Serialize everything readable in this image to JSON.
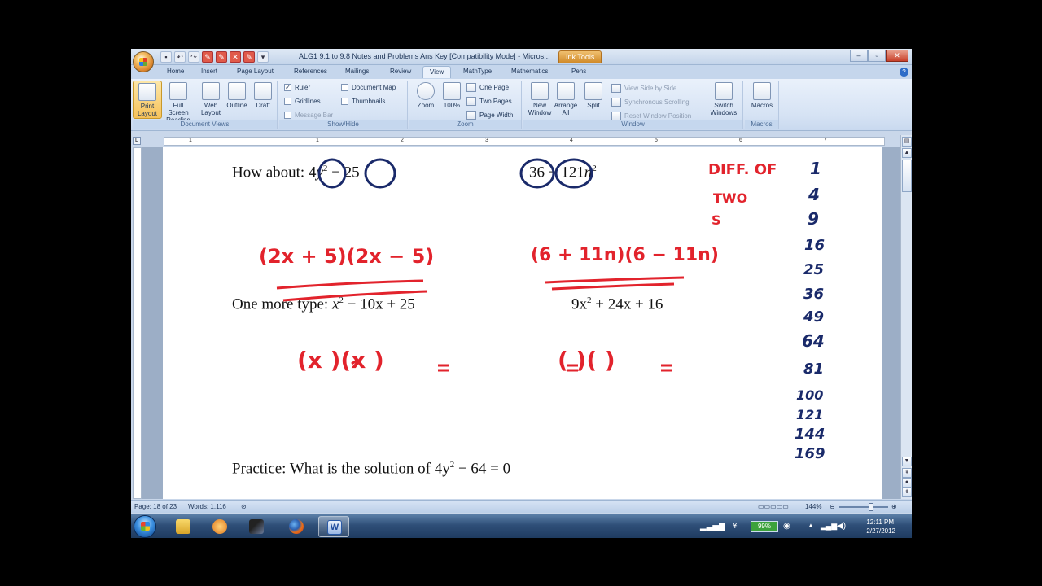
{
  "window": {
    "title": "ALG1 9.1 to 9.8 Notes and Problems Ans Key [Compatibility Mode] - Micros...",
    "ink_tools_tab": "Ink Tools"
  },
  "ribbon_tabs": [
    "Home",
    "Insert",
    "Page Layout",
    "References",
    "Mailings",
    "Review",
    "View",
    "MathType",
    "Mathematics",
    "Pens"
  ],
  "ribbon": {
    "document_views": {
      "label": "Document Views",
      "buttons": [
        "Print Layout",
        "Full Screen Reading",
        "Web Layout",
        "Outline",
        "Draft"
      ]
    },
    "show_hide": {
      "label": "Show/Hide",
      "options": [
        "Ruler",
        "Gridlines",
        "Message Bar",
        "Document Map",
        "Thumbnails"
      ]
    },
    "zoom": {
      "label": "Zoom",
      "buttons": [
        "Zoom",
        "100%",
        "One Page",
        "Two Pages",
        "Page Width"
      ]
    },
    "window": {
      "label": "Window",
      "buttons": [
        "New Window",
        "Arrange All",
        "Split",
        "View Side by Side",
        "Synchronous Scrolling",
        "Reset Window Position",
        "Switch Windows"
      ]
    },
    "macros": {
      "label": "Macros",
      "button": "Macros"
    }
  },
  "ruler_numbers": [
    "1",
    "1",
    "2",
    "3",
    "4",
    "5",
    "6",
    "7"
  ],
  "document": {
    "line1_left_prefix": "How about:",
    "line1_left_a": "4",
    "line1_left_b": "y",
    "line1_left_c": "25",
    "line1_right_a": "36",
    "line1_right_b": "121",
    "line1_right_c": "n",
    "line2_prefix": "One more type:",
    "line2_left": "x",
    "line2_left_rest": "− 10x + 25",
    "line2_right": "9x",
    "line2_right_rest": "+ 24x + 16",
    "practice": "Practice:  What is the solution of",
    "practice_eq": "4y",
    "practice_eq_rest": "− 64 = 0"
  },
  "ink": {
    "red_factor_left": "(2x + 5)(2x − 5)",
    "red_factor_right": "(6 + 11n)(6 − 11n)",
    "red_note_1": "DIFF.  OF",
    "red_note_2": "TWO",
    "red_note_3": "S",
    "red_parens_1": "(x      )(x      )",
    "red_parens_2": "(          )(      )",
    "squares": [
      "1",
      "4",
      "9",
      "16",
      "25",
      "36",
      "49",
      "64",
      "81",
      "100",
      "121",
      "144",
      "169"
    ]
  },
  "statusbar": {
    "page": "Page: 18 of 23",
    "words": "Words: 1,116",
    "zoom": "144%"
  },
  "tray": {
    "battery": "99%",
    "time": "12:11 PM",
    "date": "2/27/2012"
  }
}
